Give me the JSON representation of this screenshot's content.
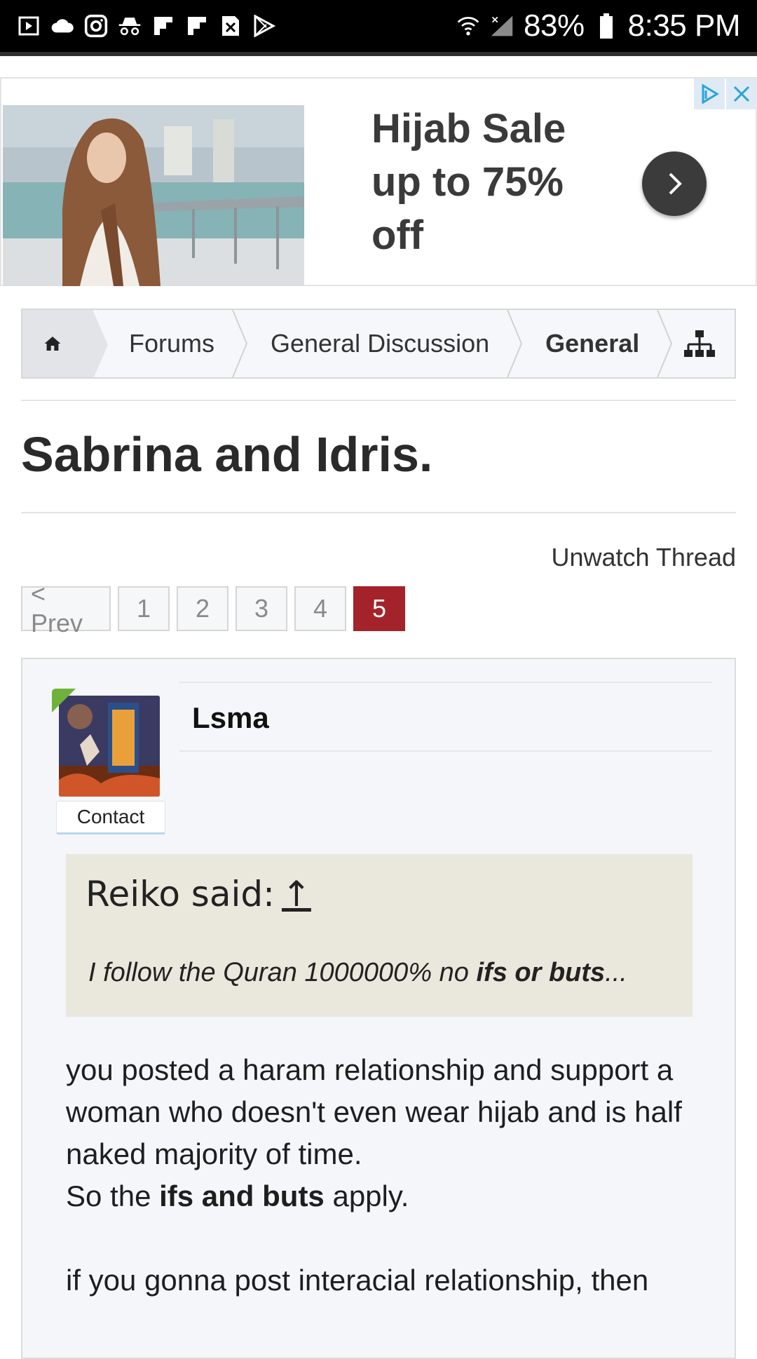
{
  "status_bar": {
    "battery": "83%",
    "time": "8:35 PM",
    "left_icons": [
      "media-icon",
      "cloud-icon",
      "instagram-icon",
      "incognito-icon",
      "flipboard-icon",
      "flipboard-icon",
      "close-box-icon",
      "play-store-icon"
    ],
    "right_icons": [
      "wifi-icon",
      "no-signal-icon",
      "battery-icon"
    ]
  },
  "ad": {
    "title": "Hijab Sale up to 75% off"
  },
  "breadcrumb": {
    "items": [
      "Forums",
      "General Discussion",
      "General"
    ]
  },
  "thread": {
    "title": "Sabrina and Idris.",
    "unwatch_label": "Unwatch Thread"
  },
  "pagination": {
    "prev_label": "< Prev",
    "pages": [
      "1",
      "2",
      "3",
      "4",
      "5"
    ],
    "current": "5"
  },
  "post": {
    "username": "Lsma",
    "contact_label": "Contact",
    "quote": {
      "author": "Reiko said:",
      "up_glyph": "↑",
      "text_plain": "I follow the Quran 1000000% no ",
      "text_bold": "ifs or buts",
      "text_end": "..."
    },
    "p1": "you posted a haram relationship and support a woman who doesn't even wear hijab and is half naked majority of time.",
    "p2_a": "So the ",
    "p2_bold": "ifs and buts",
    "p2_b": " apply.",
    "p3": "if you gonna post interacial relationship, then"
  }
}
